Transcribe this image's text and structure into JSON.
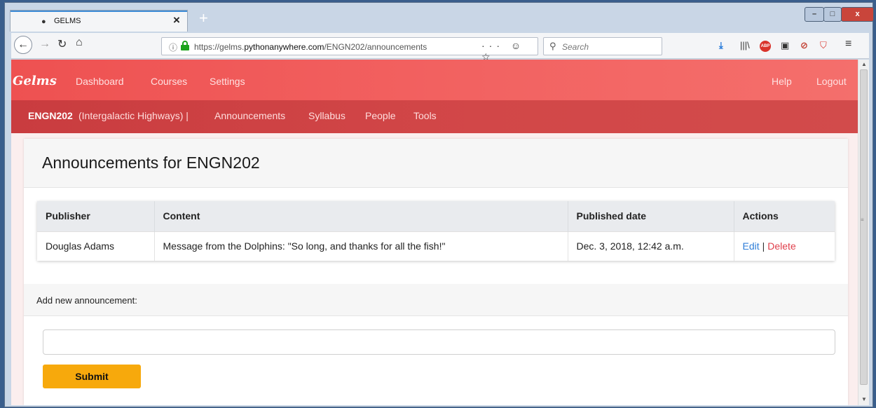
{
  "browser": {
    "tab_title": "GELMS",
    "new_tab": "+",
    "close_tab": "×",
    "url_host": "https://gelms.",
    "url_domain": "pythonanywhere.com",
    "url_path": "/ENGN202/announcements",
    "url_actions": "··· ☺ ☆",
    "search_placeholder": "Search",
    "window_min": "–",
    "window_max": "□",
    "window_close": "x"
  },
  "nav": {
    "brand": "Gelms",
    "dashboard": "Dashboard",
    "courses": "Courses",
    "settings": "Settings",
    "help": "Help",
    "logout": "Logout"
  },
  "course": {
    "code": "ENGN202",
    "name": "(Intergalactic Highways) |",
    "links": {
      "announcements": "Announcements",
      "syllabus": "Syllabus",
      "people": "People",
      "tools": "Tools"
    }
  },
  "main": {
    "title": "Announcements for ENGN202",
    "table": {
      "headers": [
        "Publisher",
        "Content",
        "Published date",
        "Actions"
      ],
      "rows": [
        {
          "publisher": "Douglas Adams",
          "content": "Message from the Dolphins: \"So long, and thanks for all the fish!\"",
          "date": "Dec. 3, 2018, 12:42 a.m.",
          "edit": "Edit",
          "sep": "|",
          "delete": "Delete"
        }
      ]
    },
    "add_label": "Add new announcement:",
    "input_value": "",
    "submit": "Submit"
  }
}
